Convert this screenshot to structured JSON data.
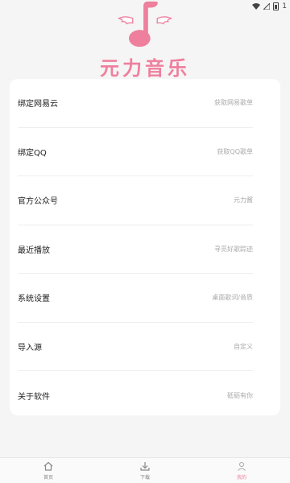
{
  "status_bar": {
    "icons": [
      "wifi-icon",
      "signal-icon",
      "battery-icon"
    ],
    "battery_text": "1"
  },
  "header": {
    "logo": "music-note-wings-icon",
    "title": "元力音乐"
  },
  "menu": {
    "items": [
      {
        "label": "绑定网易云",
        "value": "获取网易歌单"
      },
      {
        "label": "绑定QQ",
        "value": "获取QQ歌单"
      },
      {
        "label": "官方公众号",
        "value": "元力酱"
      },
      {
        "label": "最近播放",
        "value": "寻觅好歌踪迹"
      },
      {
        "label": "系统设置",
        "value": "桌面歌词/音质"
      },
      {
        "label": "导入源",
        "value": "自定义"
      },
      {
        "label": "关于软件",
        "value": "砥砺有你"
      }
    ]
  },
  "bottom_nav": {
    "items": [
      {
        "label": "首页",
        "icon": "home-icon"
      },
      {
        "label": "下载",
        "icon": "download-icon"
      },
      {
        "label": "我的",
        "icon": "user-icon",
        "active": true
      }
    ]
  },
  "colors": {
    "accent": "#ee7f9d",
    "background": "#f5f5f5",
    "card": "#ffffff"
  }
}
